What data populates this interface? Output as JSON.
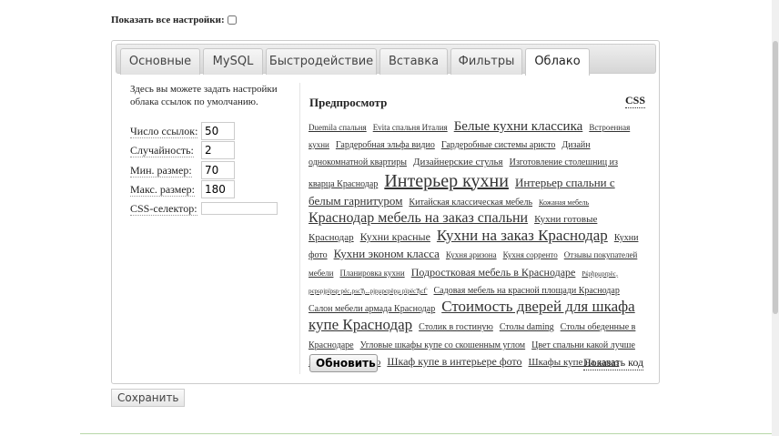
{
  "show_all": {
    "label": "Показать все настройки:"
  },
  "tabs": [
    "Основные",
    "MySQL",
    "Быстродействие",
    "Вставка",
    "Фильтры",
    "Облако"
  ],
  "active_tab": "Облако",
  "left": {
    "description": "Здесь вы можете задать настройки облака ссылок по умолчанию.",
    "fields": [
      {
        "label": "Число ссылок:",
        "value": "50"
      },
      {
        "label": "Случайность:",
        "value": "2"
      },
      {
        "label": "Мин. размер:",
        "value": "70"
      },
      {
        "label": "Макс. размер:",
        "value": "180"
      },
      {
        "label": "CSS-селектор:",
        "value": ""
      }
    ]
  },
  "preview": {
    "title": "Предпросмотр",
    "css_link": "CSS",
    "refresh": "Обновить",
    "show_code": "Показать код"
  },
  "cloud": [
    {
      "t": "Duemila спальня",
      "s": 9
    },
    {
      "t": "Evita спальня Италия",
      "s": 9
    },
    {
      "t": "Белые кухни классика",
      "s": 15
    },
    {
      "t": "Встроенная кухни",
      "s": 9
    },
    {
      "t": "Гардеробная эльфа видио",
      "s": 10
    },
    {
      "t": "Гардеробные системы аристо",
      "s": 10
    },
    {
      "t": "Дизайн однокомнатной квартиры",
      "s": 10
    },
    {
      "t": "Дизайнерские стулья",
      "s": 11
    },
    {
      "t": "Изготовление столешниц из кварца Краснодар",
      "s": 10
    },
    {
      "t": "Интерьер кухни",
      "s": 20
    },
    {
      "t": "Интерьер спальни с белым гарнитуром",
      "s": 13
    },
    {
      "t": "Китайская классическая мебель",
      "s": 10
    },
    {
      "t": "Кожаная мебель",
      "s": 8
    },
    {
      "t": "Краснодар мебель на заказ спальни",
      "s": 16
    },
    {
      "t": "Кухни готовые Краснодар",
      "s": 11
    },
    {
      "t": "Кухни красные",
      "s": 12
    },
    {
      "t": "Кухни на заказ Краснодар",
      "s": 17
    },
    {
      "t": "Кухни фото",
      "s": 10
    },
    {
      "t": "Кухни эконом класса",
      "s": 13
    },
    {
      "t": "Кухня аризона",
      "s": 9
    },
    {
      "t": "Кухня сорренто",
      "s": 9
    },
    {
      "t": "Отзывы покупателей мебели",
      "s": 9
    },
    {
      "t": "Планировка кухни",
      "s": 9
    },
    {
      "t": "Подростковая мебель в Краснодаре",
      "s": 12
    },
    {
      "t": "Рќрђрµрґрёс‚ рєрѕрјрїрѕр·рёс‚рѕсЂ...рјрµрєрёрµ рїрёсЂсЃ",
      "s": 7
    },
    {
      "t": "Садовая мебель на красной площади Краснодар",
      "s": 10
    },
    {
      "t": "Салон мебели армада Краснодар",
      "s": 10
    },
    {
      "t": "Стоимость дверей для шкафа купе Краснодар",
      "s": 17
    },
    {
      "t": "Столик в гостиную",
      "s": 10
    },
    {
      "t": "Столы daming",
      "s": 10
    },
    {
      "t": "Столы обеденные в Краснодаре",
      "s": 10
    },
    {
      "t": "Угловые шкафы купе со скошенным углом",
      "s": 10
    },
    {
      "t": "Цвет спальни какой лучше",
      "s": 10
    },
    {
      "t": "Шкаф в спальню",
      "s": 11
    },
    {
      "t": "Шкаф купе в интерьере фото",
      "s": 12
    },
    {
      "t": "Шкафы купе на заказ",
      "s": 11
    }
  ],
  "save": "Сохранить"
}
